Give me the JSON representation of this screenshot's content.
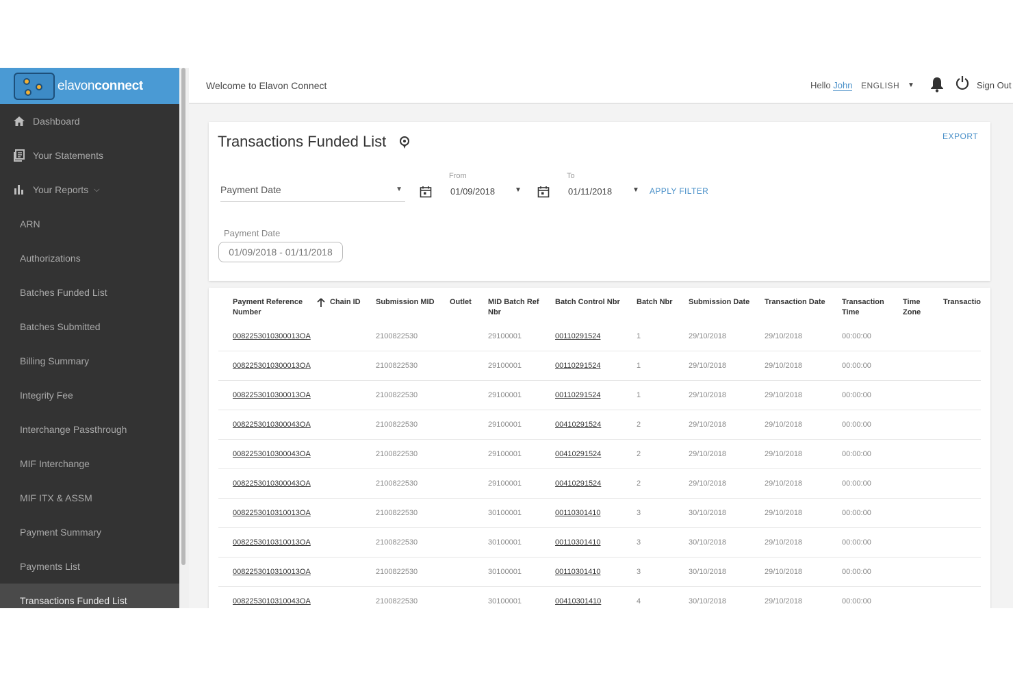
{
  "brand": {
    "logo_text_light": "elavon",
    "logo_text_bold": "connect"
  },
  "sidebar": {
    "top_items": [
      {
        "label": "Dashboard",
        "icon": "home-icon"
      },
      {
        "label": "Your Statements",
        "icon": "statements-icon"
      },
      {
        "label": "Your Reports",
        "icon": "bar-chart-icon",
        "expanded": true
      }
    ],
    "sub_items": [
      {
        "label": "ARN"
      },
      {
        "label": "Authorizations"
      },
      {
        "label": "Batches Funded List"
      },
      {
        "label": "Batches Submitted"
      },
      {
        "label": "Billing Summary"
      },
      {
        "label": "Integrity Fee"
      },
      {
        "label": "Interchange Passthrough"
      },
      {
        "label": "MIF Interchange"
      },
      {
        "label": "MIF ITX & ASSM"
      },
      {
        "label": "Payment Summary"
      },
      {
        "label": "Payments List"
      },
      {
        "label": "Transactions Funded List",
        "active": true
      }
    ]
  },
  "topbar": {
    "welcome": "Welcome to Elavon Connect",
    "hello": "Hello",
    "user": "John",
    "language": "ENGLISH",
    "sign_out": "Sign Out"
  },
  "filter": {
    "title": "Transactions Funded List",
    "export": "EXPORT",
    "date_type": "Payment Date",
    "from_label": "From",
    "from_value": "01/09/2018",
    "to_label": "To",
    "to_value": "01/11/2018",
    "apply": "APPLY FILTER",
    "chip_label": "Payment Date",
    "chip_value": "01/09/2018 - 01/11/2018"
  },
  "table": {
    "columns": [
      "Payment Reference Number",
      "Chain ID",
      "Submission MID",
      "Outlet",
      "MID Batch Ref Nbr",
      "Batch Control Nbr",
      "Batch Nbr",
      "Submission Date",
      "Transaction Date",
      "Transaction Time",
      "Time Zone",
      "Transactio"
    ],
    "rows": [
      [
        "0082253010300013OA",
        "",
        "2100822530",
        "",
        "29100001",
        "00110291524",
        "1",
        "29/10/2018",
        "29/10/2018",
        "00:00:00"
      ],
      [
        "0082253010300013OA",
        "",
        "2100822530",
        "",
        "29100001",
        "00110291524",
        "1",
        "29/10/2018",
        "29/10/2018",
        "00:00:00"
      ],
      [
        "0082253010300013OA",
        "",
        "2100822530",
        "",
        "29100001",
        "00110291524",
        "1",
        "29/10/2018",
        "29/10/2018",
        "00:00:00"
      ],
      [
        "0082253010300043OA",
        "",
        "2100822530",
        "",
        "29100001",
        "00410291524",
        "2",
        "29/10/2018",
        "29/10/2018",
        "00:00:00"
      ],
      [
        "0082253010300043OA",
        "",
        "2100822530",
        "",
        "29100001",
        "00410291524",
        "2",
        "29/10/2018",
        "29/10/2018",
        "00:00:00"
      ],
      [
        "0082253010300043OA",
        "",
        "2100822530",
        "",
        "29100001",
        "00410291524",
        "2",
        "29/10/2018",
        "29/10/2018",
        "00:00:00"
      ],
      [
        "0082253010310013OA",
        "",
        "2100822530",
        "",
        "30100001",
        "00110301410",
        "3",
        "30/10/2018",
        "29/10/2018",
        "00:00:00"
      ],
      [
        "0082253010310013OA",
        "",
        "2100822530",
        "",
        "30100001",
        "00110301410",
        "3",
        "30/10/2018",
        "29/10/2018",
        "00:00:00"
      ],
      [
        "0082253010310013OA",
        "",
        "2100822530",
        "",
        "30100001",
        "00110301410",
        "3",
        "30/10/2018",
        "29/10/2018",
        "00:00:00"
      ],
      [
        "0082253010310043OA",
        "",
        "2100822530",
        "",
        "30100001",
        "00410301410",
        "4",
        "30/10/2018",
        "29/10/2018",
        "00:00:00"
      ]
    ]
  },
  "colors": {
    "accent": "#4a90c8",
    "sidebar": "#333333",
    "logo_bar": "#4a9ad4"
  }
}
